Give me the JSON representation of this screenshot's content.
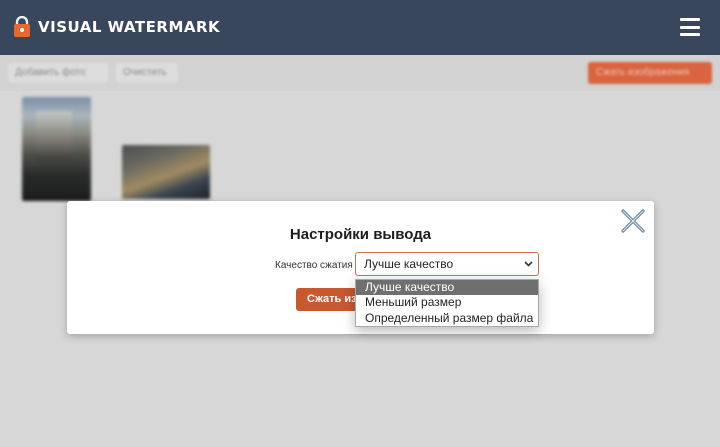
{
  "header": {
    "title": "VISUAL WATERMARK",
    "logo_icon": "lock-icon",
    "menu_icon": "hamburger-menu-icon",
    "background": "#39475d"
  },
  "toolbar": {
    "add_photo_label": "Добавить фото",
    "clear_label": "Очистить",
    "action_label": "Сжать изображения",
    "accent": "#d9643e"
  },
  "modal": {
    "title": "Настройки вывода",
    "close_icon": "close-icon",
    "quality_label": "Качество сжатия",
    "quality_selected": "Лучше качество",
    "compress_button_label": "Сжать изображения",
    "button_color": "#c9582f"
  },
  "dropdown": {
    "options": [
      {
        "label": "Лучше качество",
        "selected": true
      },
      {
        "label": "Меньший размер",
        "selected": false
      },
      {
        "label": "Определенный размер файла",
        "selected": false
      }
    ]
  }
}
